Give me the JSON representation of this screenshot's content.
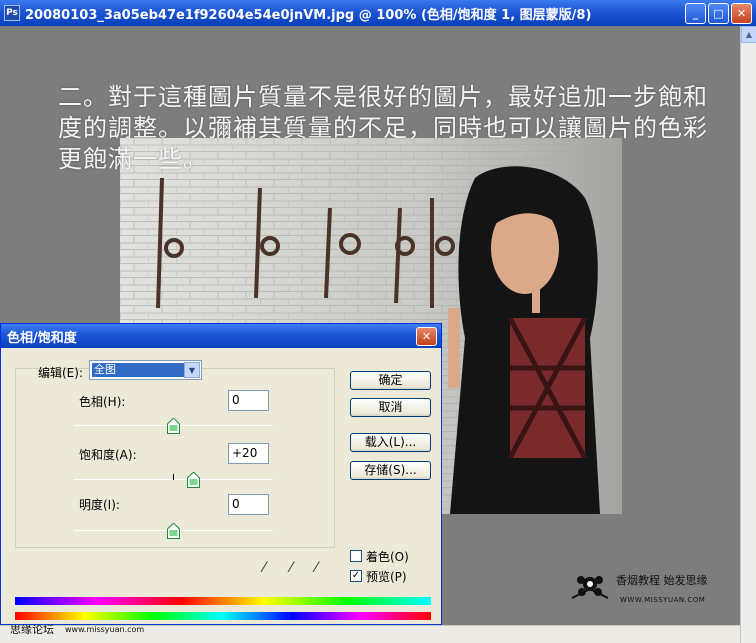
{
  "window": {
    "title": "20080103_3a05eb47e1f92604e54e0jnVM.jpg @ 100% (色相/饱和度 1, 图层蒙版/8)",
    "controls": [
      "minimize",
      "maximize",
      "close"
    ]
  },
  "overlay_text": "二。對于這種圖片質量不是很好的圖片，最好追加一步飽和度的調整。以彌補其質量的不足，同時也可以讓圖片的色彩更飽滿一些。",
  "dialog": {
    "title": "色相/饱和度",
    "edit_label": "编辑(E):",
    "edit_value": "全图",
    "hue_label": "色相(H):",
    "hue_value": "0",
    "saturation_label": "饱和度(A):",
    "saturation_value": "+20",
    "lightness_label": "明度(I):",
    "lightness_value": "0",
    "buttons": {
      "ok": "确定",
      "cancel": "取消",
      "load": "载入(L)...",
      "save": "存储(S)..."
    },
    "colorize_label": "着色(O)",
    "colorize_checked": false,
    "preview_label": "预览(P)",
    "preview_checked": true
  },
  "slider_levels": {
    "hue": 0.5,
    "saturation": 0.6,
    "lightness": 0.5
  },
  "watermark": {
    "line1": "香烟教程 始发思缘",
    "line2": "WWW.MISSYUAN.COM"
  },
  "footer": {
    "forum": "思缘论坛",
    "url": "www.missyuan.com"
  },
  "colors": {
    "title_bar": "#1d55d4",
    "dialog_bg": "#ece9d8",
    "canvas_bg": "#7d7d7d",
    "selection": "#316ac5"
  }
}
